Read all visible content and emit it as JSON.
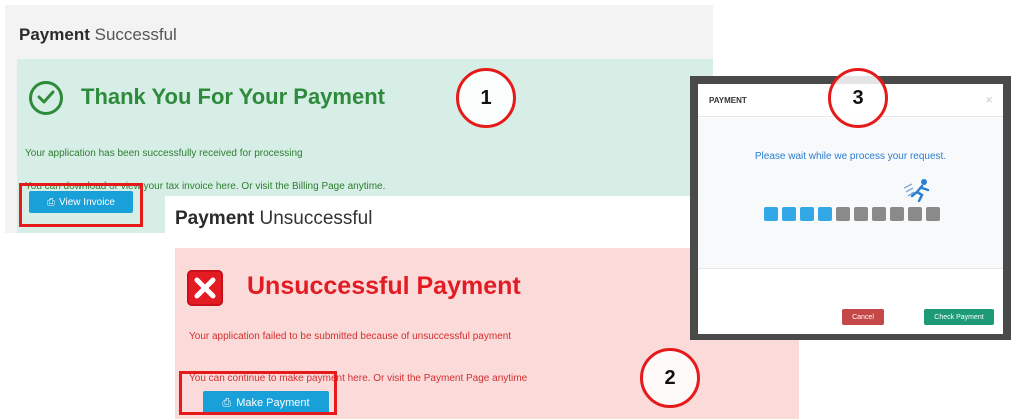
{
  "success": {
    "header_bold": "Payment",
    "header_light": "Successful",
    "title": "Thank You For Your Payment",
    "line1": "Your application has been successfully received for processing",
    "line2": "You can download or view your tax invoice here. Or visit the Billing Page anytime.",
    "button": "View Invoice",
    "icon": "check-circle-icon",
    "color": "#2e8b3c"
  },
  "fail": {
    "header_bold": "Payment",
    "header_light": "Unsuccessful",
    "title": "Unsuccessful Payment",
    "line1": "Your application failed to be submitted because of unsuccessful payment",
    "line2": "You can continue to make payment here. Or visit the Payment Page anytime",
    "button": "Make Payment",
    "icon": "x-box-icon",
    "color": "#e31b23"
  },
  "modal": {
    "title": "PAYMENT",
    "close": "×",
    "message": "Please wait while we process your request.",
    "progress_filled": 4,
    "progress_total": 10,
    "cancel": "Cancel",
    "check": "Check Payment"
  },
  "markers": [
    "1",
    "2",
    "3"
  ],
  "colors": {
    "accent": "#1aa0d8",
    "marker": "#e51b1b"
  }
}
